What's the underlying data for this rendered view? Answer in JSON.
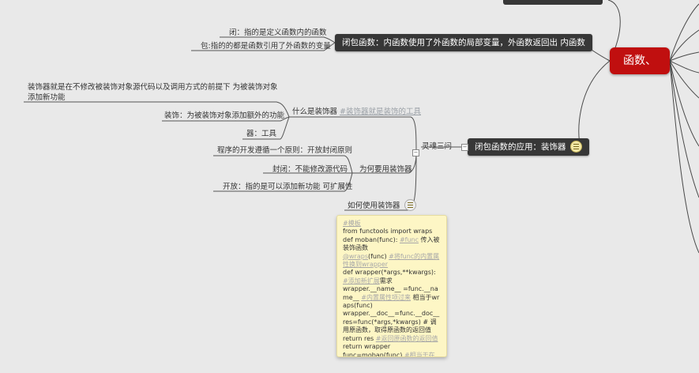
{
  "root": {
    "label": "函数、"
  },
  "closure": {
    "label": "闭包函数：内函数使用了外函数的局部变量，外函数返回出 内函数",
    "children": [
      {
        "label": "闭：指的是定义函数内的函数"
      },
      {
        "label": "包:指的的都是函数引用了外函数的变量"
      }
    ]
  },
  "decorator": {
    "label": "闭包函数的应用：装饰器",
    "soul": "灵魂三问",
    "what": {
      "label": "什么是装饰器",
      "comment": "#装饰器就是装饰的工具",
      "children": [
        {
          "label": "装饰器就是在不修改被装饰对象源代码以及调用方式的前提下 为被装饰对象添加新功能"
        },
        {
          "label": "装饰：为被装饰对象添加额外的功能"
        },
        {
          "label": "器：工具"
        }
      ]
    },
    "why": {
      "label": "为何要用装饰器",
      "children": [
        {
          "label": "程序的开发遵循一个原则：开放封闭原则"
        },
        {
          "label": "封闭：不能修改源代码"
        },
        {
          "label": "开放：指的是可以添加新功能 可扩展性"
        }
      ]
    },
    "how": {
      "label": "如何使用装饰器"
    }
  },
  "note": {
    "lines": [
      [
        {
          "t": "#模板",
          "c": true
        }
      ],
      [
        {
          "t": "from functools import wraps"
        }
      ],
      [
        {
          "t": "def moban(func): "
        },
        {
          "t": "#func",
          "c": true
        },
        {
          "t": " 传入被装饰函数"
        }
      ],
      [
        {
          "t": "    "
        },
        {
          "t": "@wraps",
          "c": true
        },
        {
          "t": "(func)   "
        },
        {
          "t": "#将func的内置属性换到wrapper",
          "c": true
        }
      ],
      [
        {
          "t": "    def wrapper(*args,**kwargs): "
        },
        {
          "t": "#添加新扩展",
          "c": true
        },
        {
          "t": "需求"
        }
      ],
      [
        {
          "t": "        wrapper.__name__ =func.__name__  "
        },
        {
          "t": "#内置属性项过来",
          "c": true
        },
        {
          "t": " 相当于wraps(func)"
        }
      ],
      [
        {
          "t": "        wrapper.__doc__=func.__doc__"
        }
      ],
      [
        {
          "t": "        res=func(*args,*kwargs) #  调用原函数，取得原函数的返回值"
        }
      ],
      [
        {
          "t": "        return res   "
        },
        {
          "t": "#返回原函数的返回值",
          "c": true
        }
      ],
      [
        {
          "t": "    return wrapper"
        }
      ],
      [
        {
          "t": "func=moban(func)  "
        },
        {
          "t": "#相当于在函数正上方@moban",
          "c": true
        }
      ]
    ]
  }
}
